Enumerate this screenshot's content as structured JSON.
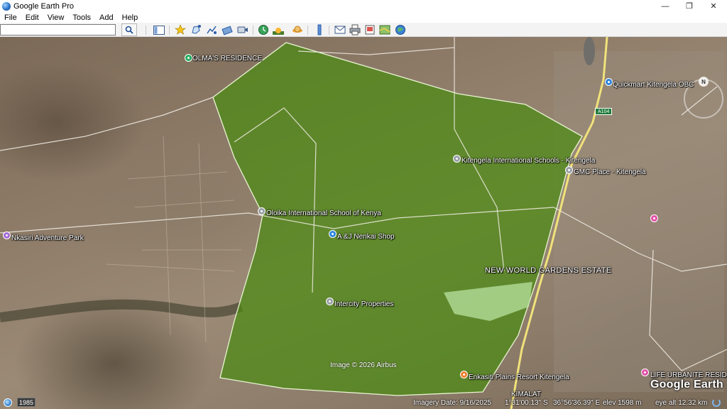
{
  "window": {
    "title": "Google Earth Pro",
    "minimize_glyph": "—",
    "maximize_glyph": "❐",
    "close_glyph": "✕"
  },
  "menu": [
    "File",
    "Edit",
    "View",
    "Tools",
    "Add",
    "Help"
  ],
  "search": {
    "value": "",
    "placeholder": ""
  },
  "toolbar_icons": [
    "sidebar-toggle-icon",
    "placemark-icon",
    "polygon-icon",
    "path-icon",
    "image-overlay-icon",
    "record-tour-icon",
    "historical-imagery-icon",
    "sunlight-icon",
    "planets-icon",
    "ruler-icon",
    "email-icon",
    "print-icon",
    "save-image-icon",
    "view-in-maps-icon",
    "earth-gallery-icon"
  ],
  "map": {
    "places": [
      {
        "name": "OLMA'S RESIDENCE",
        "color": "#27ae60"
      },
      {
        "name": "Quickmart Kitengela OBC",
        "color": "#2e86de"
      },
      {
        "name": "Kitengela International Schools - Kitengela",
        "color": "#9aa0a6"
      },
      {
        "name": "GMC Place - Kitengela",
        "color": "#9aa0a6"
      },
      {
        "name": "Oloika International School of Kenya",
        "color": "#9aa0a6"
      },
      {
        "name": "A &J Nenkai Shop",
        "color": "#2e86de"
      },
      {
        "name": "Nkasiri Adventure Park",
        "color": "#a66ad8"
      },
      {
        "name": "NEW WORLD GARDENS ESTATE",
        "color": ""
      },
      {
        "name": "Intercity Properties",
        "color": "#9aa0a6"
      },
      {
        "name": "Enkasiti Plains Resort Kitengela",
        "color": "#ef7d2d"
      },
      {
        "name": "LIFE URBANITE RESID",
        "color": "#e34fa8"
      },
      {
        "name": "KIMALAT",
        "color": ""
      }
    ],
    "route_badge": "A104",
    "compass_label": "N",
    "copyright": "Image © 2026 Airbus",
    "logo": "Google Earth",
    "polygon_fill": "#4b8a12"
  },
  "status": {
    "year": "1985",
    "imagery_date": "Imagery Date: 9/16/2025",
    "lat": "1°31'00.13\" S",
    "lon": "36°56'36.39\" E",
    "elev": "elev  1598 m",
    "eye_alt": "eye alt  12.32 km"
  }
}
